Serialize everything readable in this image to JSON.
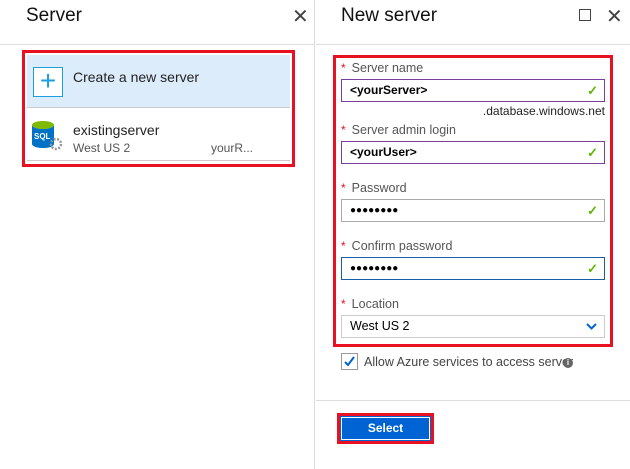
{
  "left_panel": {
    "title": "Server",
    "items": [
      {
        "label": "Create a new server",
        "icon": "plus-icon"
      },
      {
        "name": "existingserver",
        "location": "West US 2",
        "resource_group": "yourR...",
        "icon": "sql-server-icon"
      }
    ]
  },
  "right_panel": {
    "title": "New server",
    "fields": [
      {
        "label": "Server name",
        "value": "<yourServer>",
        "suffix": ".database.windows.net"
      },
      {
        "label": "Server admin login",
        "value": "<yourUser>"
      },
      {
        "label": "Password",
        "value": "●●●●●●●●"
      },
      {
        "label": "Confirm password",
        "value": "●●●●●●●●"
      },
      {
        "label": "Location",
        "value": "West US 2"
      }
    ],
    "allow_azure": {
      "label": "Allow Azure services to access server",
      "checked": true
    },
    "select_label": "Select"
  },
  "colors": {
    "accent": "#0063d3",
    "highlight": "#e81123",
    "selected_bg": "#dcecfa",
    "valid": "#5cb800"
  }
}
